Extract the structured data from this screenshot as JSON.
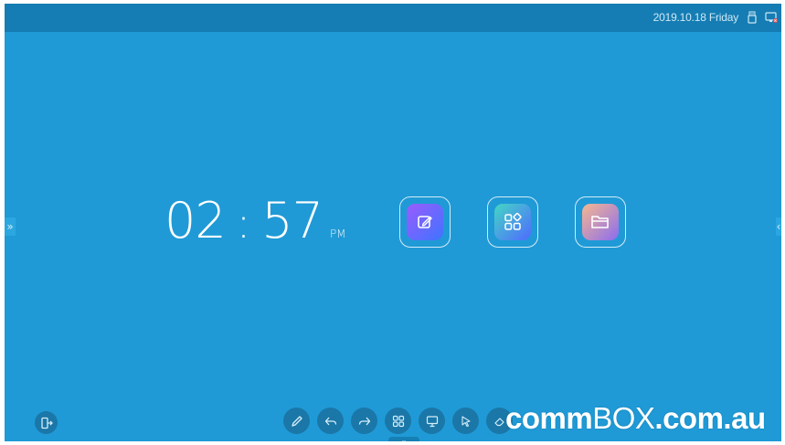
{
  "topbar": {
    "date_text": "2019.10.18 Friday",
    "usb_icon": "usb-drive-icon",
    "display_icon": "display-signal-icon"
  },
  "side_handles": {
    "left_glyph": "»",
    "right_glyph": "‹"
  },
  "clock": {
    "hour": "02",
    "separator": ":",
    "minute": "57",
    "ampm": "PM"
  },
  "apps": [
    {
      "name": "whiteboard",
      "icon": "note-pen-icon"
    },
    {
      "name": "apps",
      "icon": "app-grid-icon"
    },
    {
      "name": "files",
      "icon": "folder-icon"
    }
  ],
  "bottom_bar": {
    "exit_icon": "exit-door-icon",
    "tools": [
      {
        "icon": "pen-icon"
      },
      {
        "icon": "undo-icon"
      },
      {
        "icon": "redo-icon"
      },
      {
        "icon": "apps-grid-icon"
      },
      {
        "icon": "screen-share-icon"
      },
      {
        "icon": "pointer-icon"
      },
      {
        "icon": "eraser-icon"
      }
    ],
    "pull_glyph": "⌄"
  },
  "watermark": {
    "bold_part_1": "comm",
    "light_part": "BOX",
    "bold_part_2": ".com.au"
  },
  "colors": {
    "background": "#1f9ad6",
    "topbar": "#157db3",
    "button": "#1a77a8"
  }
}
